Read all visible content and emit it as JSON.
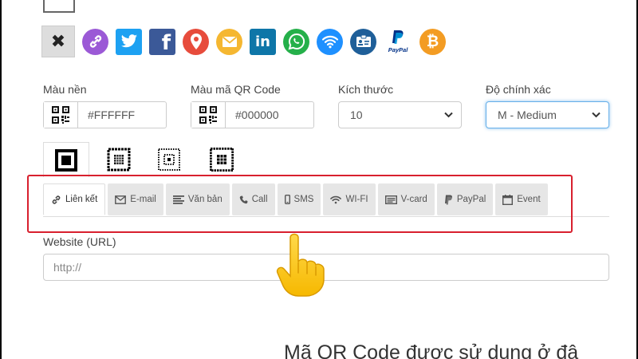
{
  "icons": [
    {
      "name": "close-icon",
      "glyph": "✖",
      "color": "#222222",
      "shape": "button"
    },
    {
      "name": "link-icon",
      "glyph": "🔗",
      "color": "#9b59d6",
      "shape": "circle"
    },
    {
      "name": "twitter-icon",
      "glyph": "t",
      "color": "#1da1f2",
      "shape": "square"
    },
    {
      "name": "facebook-icon",
      "glyph": "f",
      "color": "#3b5998",
      "shape": "square"
    },
    {
      "name": "location-pin-icon",
      "glyph": "◉",
      "color": "#e74c3c",
      "shape": "circle"
    },
    {
      "name": "email-icon",
      "glyph": "✉",
      "color": "#f5b731",
      "shape": "circle"
    },
    {
      "name": "linkedin-icon",
      "glyph": "in",
      "color": "#0e76a8",
      "shape": "square"
    },
    {
      "name": "whatsapp-icon",
      "glyph": "✆",
      "color": "#25b04a",
      "shape": "circle"
    },
    {
      "name": "wifi-icon",
      "glyph": "((·))",
      "color": "#1e90ff",
      "shape": "circle"
    },
    {
      "name": "vcard-icon",
      "glyph": "▤",
      "color": "#1f5f99",
      "shape": "circle"
    },
    {
      "name": "paypal-icon",
      "glyph": "P",
      "color": "#003087",
      "shape": "paypal"
    },
    {
      "name": "bitcoin-icon",
      "glyph": "₿",
      "color": "#f39c23",
      "shape": "circle"
    }
  ],
  "paypal_small": "PayPal",
  "fields": {
    "bg_color_label": "Màu nền",
    "bg_color_value": "#FFFFFF",
    "qr_color_label": "Màu mã QR Code",
    "qr_color_value": "#000000",
    "size_label": "Kích thước",
    "size_value": "10",
    "accuracy_label": "Độ chính xác",
    "accuracy_value": "M - Medium"
  },
  "tabs": [
    {
      "name": "tab-link",
      "icon": "link-icon",
      "glyph": "🔗",
      "label": "Liên kết",
      "active": true
    },
    {
      "name": "tab-email",
      "icon": "envelope-icon",
      "glyph": "✉",
      "label": "E-mail"
    },
    {
      "name": "tab-text",
      "icon": "text-lines-icon",
      "glyph": "≡",
      "label": "Văn bản"
    },
    {
      "name": "tab-call",
      "icon": "phone-icon",
      "glyph": "✆",
      "label": "Call"
    },
    {
      "name": "tab-sms",
      "icon": "mobile-icon",
      "glyph": "▯",
      "label": "SMS"
    },
    {
      "name": "tab-wifi",
      "icon": "wifi-icon",
      "glyph": "⌔",
      "label": "WI-FI"
    },
    {
      "name": "tab-vcard",
      "icon": "vcard-icon",
      "glyph": "▤",
      "label": "V-card"
    },
    {
      "name": "tab-paypal",
      "icon": "paypal-icon",
      "glyph": "P",
      "label": "PayPal"
    },
    {
      "name": "tab-event",
      "icon": "calendar-icon",
      "glyph": "▦",
      "label": "Event"
    }
  ],
  "url": {
    "label": "Website (URL)",
    "placeholder": "http://"
  },
  "bottom_text": "Mã QR Code được sử dụng ở đâ",
  "colors": {
    "highlight": "#d8202e",
    "focus": "#66afe9",
    "tab_bg": "#e6e6e6"
  }
}
